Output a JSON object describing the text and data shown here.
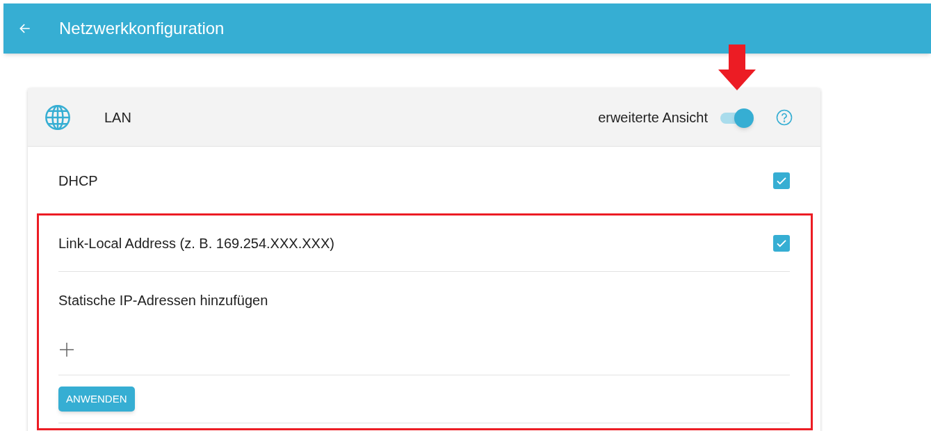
{
  "app_bar": {
    "title": "Netzwerkkonfiguration"
  },
  "card": {
    "title": "LAN",
    "advanced_view": {
      "label": "erweiterte Ansicht",
      "on": true
    },
    "options": [
      {
        "label": "DHCP",
        "checked": true
      },
      {
        "label": "Link-Local Address (z. B. 169.254.XXX.XXX)",
        "checked": true
      }
    ],
    "static_section": {
      "label": "Statische IP-Adressen hinzufügen"
    },
    "apply_button": "ANWENDEN"
  }
}
